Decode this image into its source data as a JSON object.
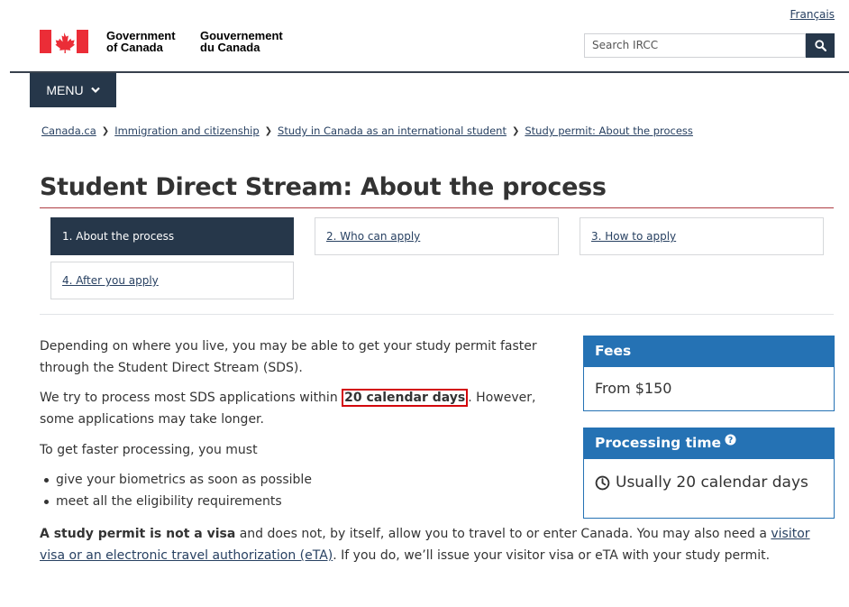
{
  "header": {
    "language_link": "Français",
    "signature_en": [
      "Government",
      "of Canada"
    ],
    "signature_fr": [
      "Gouvernement",
      "du Canada"
    ],
    "search_placeholder": "Search IRCC",
    "menu_label": "MENU",
    "icons": {
      "search": "search-icon",
      "menu": "chevron-down-icon",
      "flag": "canada-flag-icon"
    }
  },
  "breadcrumb": [
    "Canada.ca",
    "Immigration and citizenship",
    "Study in Canada as an international student",
    "Study permit: About the process"
  ],
  "page_title": "Student Direct Stream: About the process",
  "steps": [
    {
      "label": "1. About the process",
      "active": true
    },
    {
      "label": "2. Who can apply",
      "active": false
    },
    {
      "label": "3. How to apply",
      "active": false
    },
    {
      "label": "4. After you apply",
      "active": false
    }
  ],
  "content": {
    "p1": "Depending on where you live, you may be able to get your study permit faster through the Student Direct Stream (SDS).",
    "p2_before": "We try to process most SDS applications within ",
    "p2_highlight": "20 calendar days",
    "p2_after": ". However, some applications may take longer.",
    "p3": "To get faster processing, you must",
    "bullets": [
      "give your biometrics as soon as possible",
      "meet all the eligibility requirements"
    ],
    "p4_bold": "A study permit is not a visa",
    "p4_a": " and does not, by itself, allow you to travel to or enter Canada. You may also need a ",
    "p4_link": "visitor visa or an electronic travel authorization (eTA)",
    "p4_b": ". If you do, we’ll issue your visitor visa or eTA with your study permit."
  },
  "fees_panel": {
    "title": "Fees",
    "value": "From $150"
  },
  "processing_panel": {
    "title": "Processing time",
    "value": "Usually 20 calendar days",
    "icons": {
      "help": "question-circle-icon",
      "clock": "clock-icon"
    }
  },
  "colors": {
    "navy": "#26374a",
    "panel_blue": "#2572b4",
    "link": "#284162",
    "title_rule": "#af3c43",
    "highlight_box": "#d3080c",
    "flag_red": "#eb2d37"
  }
}
